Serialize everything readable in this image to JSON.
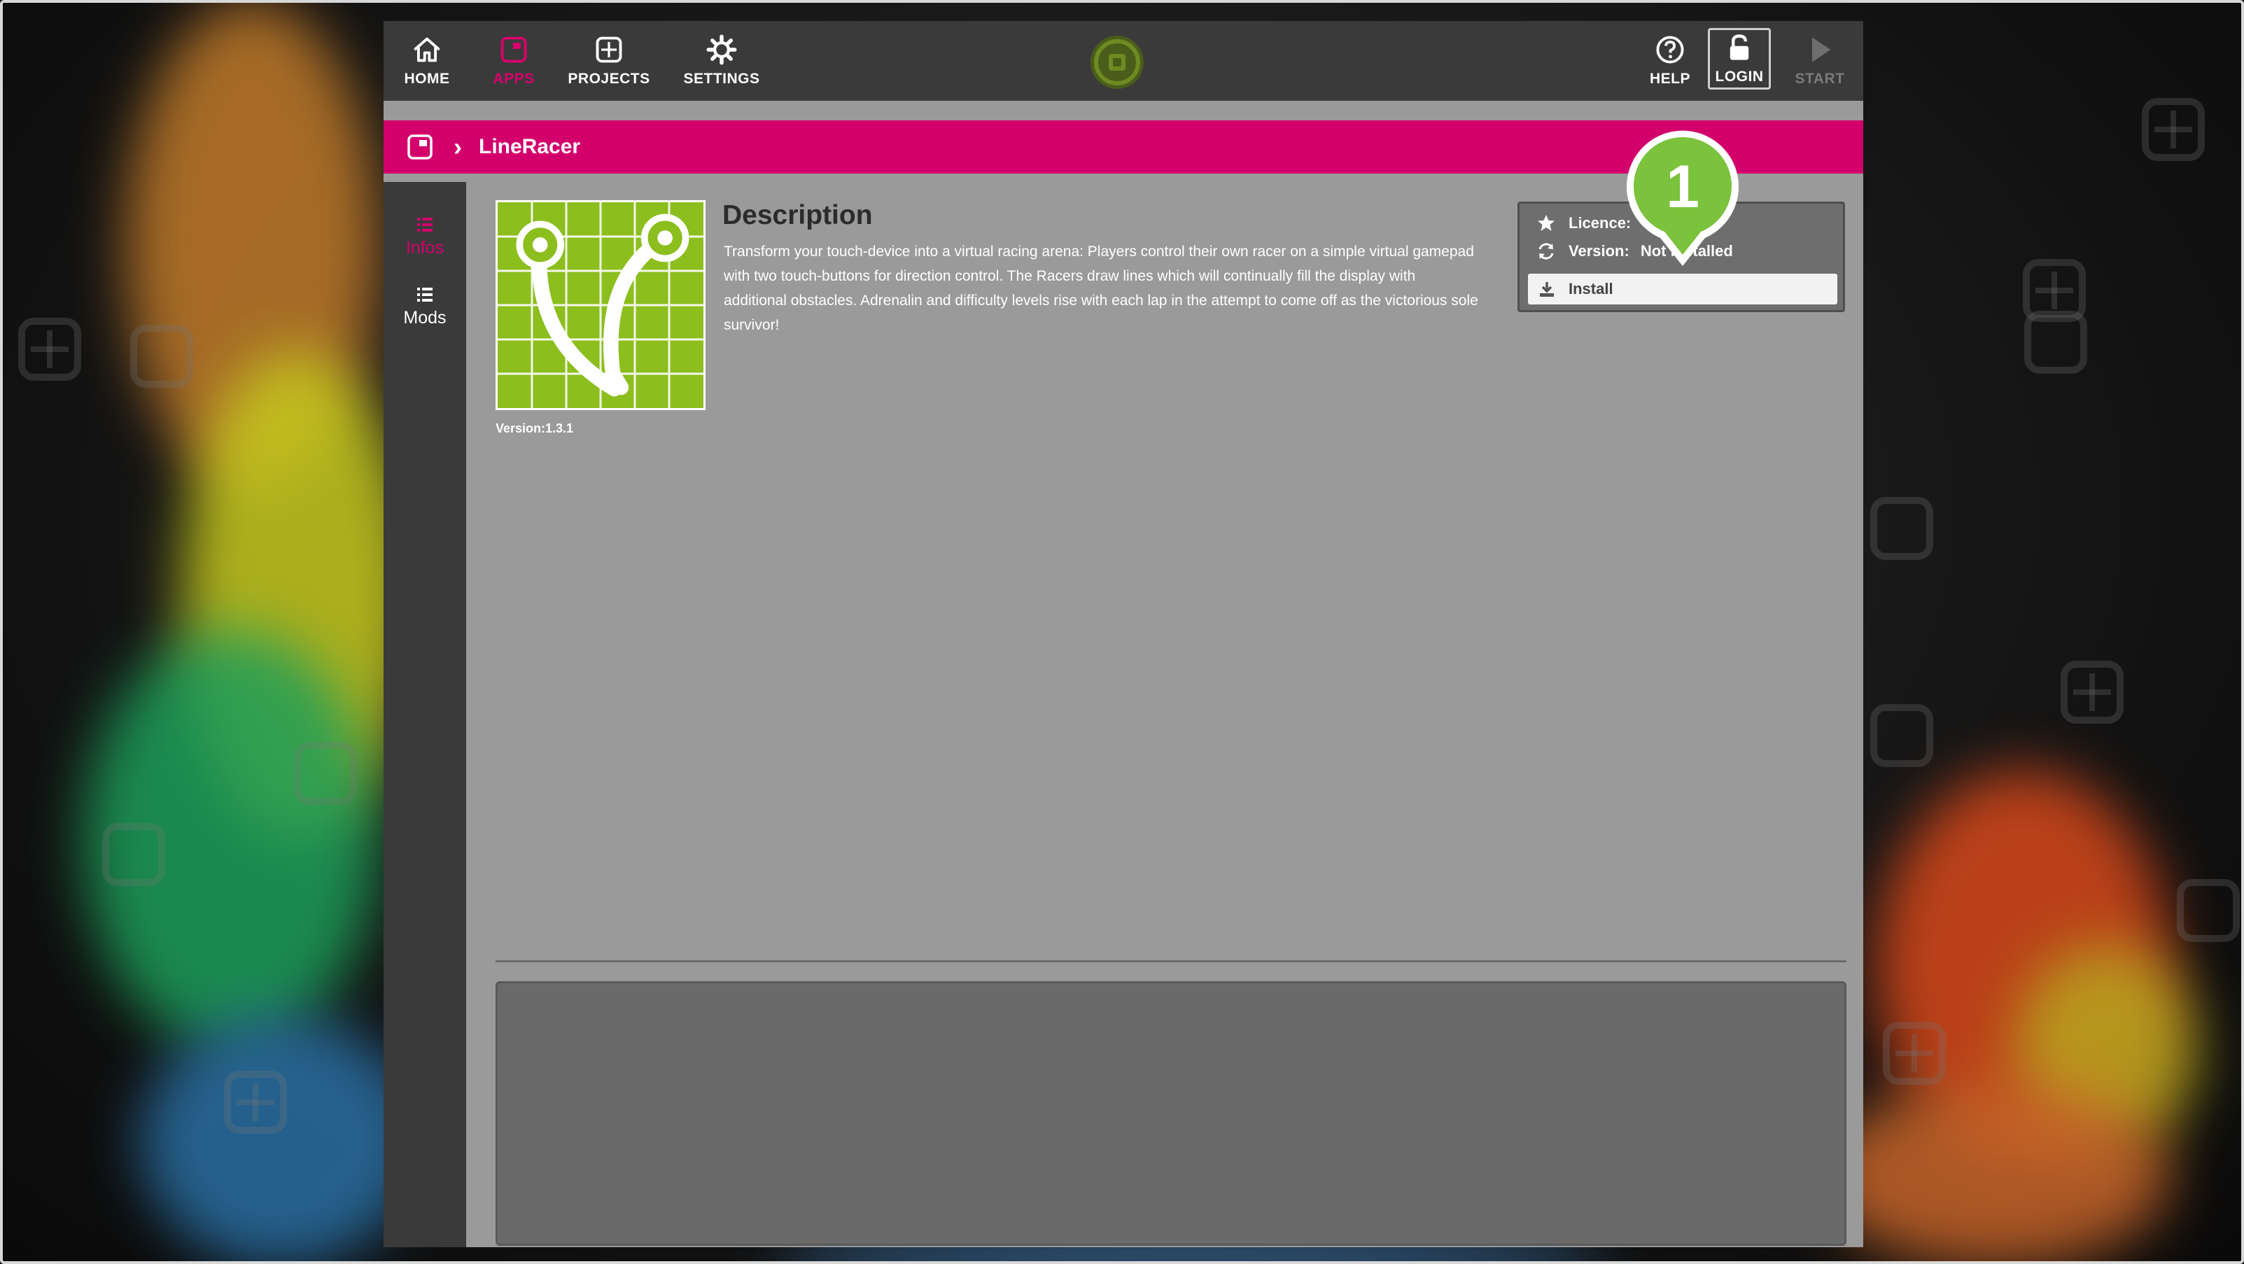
{
  "nav": {
    "home": "HOME",
    "apps": "APPS",
    "projects": "PROJECTS",
    "settings": "SETTINGS",
    "help": "HELP",
    "login": "LOGIN",
    "start": "START"
  },
  "breadcrumb": {
    "title": "LineRacer"
  },
  "sidebar": {
    "infos": "Infos",
    "mods": "Mods"
  },
  "app": {
    "version_label": "Version:1.3.1",
    "description_title": "Description",
    "description_text": "Transform your touch-device into a virtual racing arena: Players control their own racer on a simple virtual gamepad with two touch-buttons for direction control. The Racers draw lines which will continually fill the display with additional obstacles. Adrenalin and difficulty levels rise with each lap in the attempt to come off as the victorious sole survivor!"
  },
  "info_box": {
    "licence_label": "Licence:",
    "version_label": "Version:",
    "version_value": "Not installed",
    "install_label": "Install"
  },
  "callout": {
    "number": "1"
  },
  "colors": {
    "accent": "#d3006c",
    "icon_green": "#8cbe1e",
    "callout_green": "#7bc23d"
  }
}
